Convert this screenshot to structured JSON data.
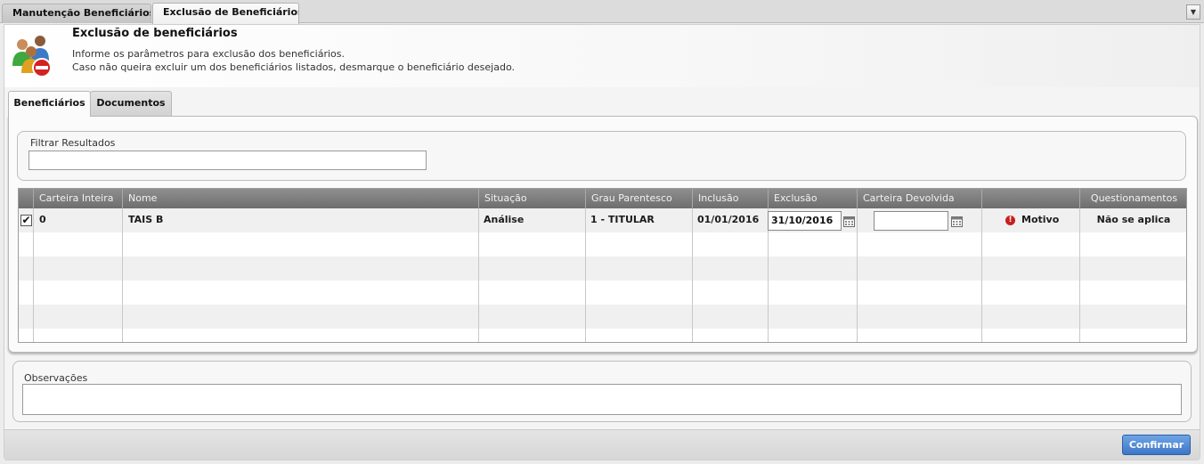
{
  "window_tabs": [
    "Manutenção Beneficiários",
    "Exclusão de Beneficiários"
  ],
  "menu_button": "▼",
  "header": {
    "title": "Exclusão de beneficiários",
    "line1": "Informe os parâmetros para exclusão dos beneficiários.",
    "line2": "Caso não queira excluir um dos beneficiários listados, desmarque o beneficiário desejado."
  },
  "tabs": [
    "Beneficiários",
    "Documentos"
  ],
  "filter": {
    "label": "Filtrar Resultados",
    "value": ""
  },
  "table": {
    "columns": [
      "Carteira Inteira",
      "Nome",
      "Situação",
      "Grau Parentesco",
      "Inclusão",
      "Exclusão",
      "Carteira Devolvida",
      "",
      "Questionamentos"
    ],
    "rows": [
      {
        "checked": true,
        "check_mark": "✔",
        "carteira": "0",
        "nome": "TAIS B",
        "situacao": "Análise",
        "grau": "1 - TITULAR",
        "inclusao": "01/01/2016",
        "exclusao": "31/10/2016",
        "carteira_devolvida": "",
        "motivo": "Motivo",
        "questionamentos": "Não se aplica"
      }
    ]
  },
  "observacoes": {
    "label": "Observações",
    "value": ""
  },
  "confirm": "Confirmar",
  "colors": {
    "accent": "#3d76c6",
    "header": "#7d7d7d",
    "warning": "#c8201c"
  },
  "icons": [
    "users-remove-icon",
    "calendar-icon",
    "warning-icon",
    "chevron-down-icon"
  ]
}
